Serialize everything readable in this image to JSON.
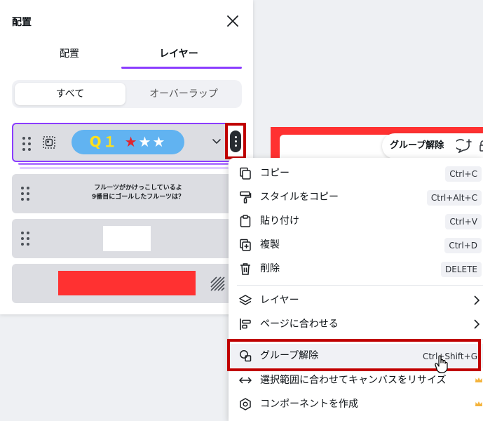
{
  "panel": {
    "title": "配置",
    "tabs": [
      {
        "label": "配置",
        "active": false
      },
      {
        "label": "レイヤー",
        "active": true
      }
    ],
    "segments": [
      {
        "label": "すべて",
        "active": true
      },
      {
        "label": "オーバーラップ",
        "active": false
      }
    ],
    "layers": [
      {
        "kind": "group",
        "text_q": "Q１",
        "text_red_star": "★",
        "text_white_stars": "★★",
        "selected": true
      },
      {
        "kind": "text",
        "line1": "フルーツがかけっこしているよ",
        "line2": "9番目にゴールしたフルーツは？"
      },
      {
        "kind": "shape",
        "color": "#ffffff"
      },
      {
        "kind": "shape",
        "color": "#ff3131"
      }
    ]
  },
  "floating_toolbar": {
    "label": "グループ解除"
  },
  "context_menu": {
    "items": [
      {
        "label": "コピー",
        "shortcut": "Ctrl+C",
        "icon": "copy-icon"
      },
      {
        "label": "スタイルをコピー",
        "shortcut": "Ctrl+Alt+C",
        "icon": "paint-roller-icon"
      },
      {
        "label": "貼り付け",
        "shortcut": "Ctrl+V",
        "icon": "clipboard-icon"
      },
      {
        "label": "複製",
        "shortcut": "Ctrl+D",
        "icon": "duplicate-icon"
      },
      {
        "label": "削除",
        "shortcut": "DELETE",
        "icon": "trash-icon"
      },
      {
        "label": "レイヤー",
        "icon": "layers-icon",
        "submenu": true
      },
      {
        "label": "ページに合わせる",
        "icon": "align-icon",
        "submenu": true
      },
      {
        "label": "グループ解除",
        "shortcut": "Ctrl+Shift+G",
        "icon": "ungroup-icon",
        "highlighted": true
      },
      {
        "label": "選択範囲に合わせてキャンバスをリサイズ",
        "icon": "resize-arrows-icon",
        "premium": true
      },
      {
        "label": "コンポーネントを作成",
        "icon": "component-icon",
        "premium": true
      }
    ]
  },
  "colors": {
    "accent": "#8b3dff",
    "annotation_red": "#c00000",
    "canvas_red": "#ff3131",
    "pill_blue": "#61b3f1"
  }
}
